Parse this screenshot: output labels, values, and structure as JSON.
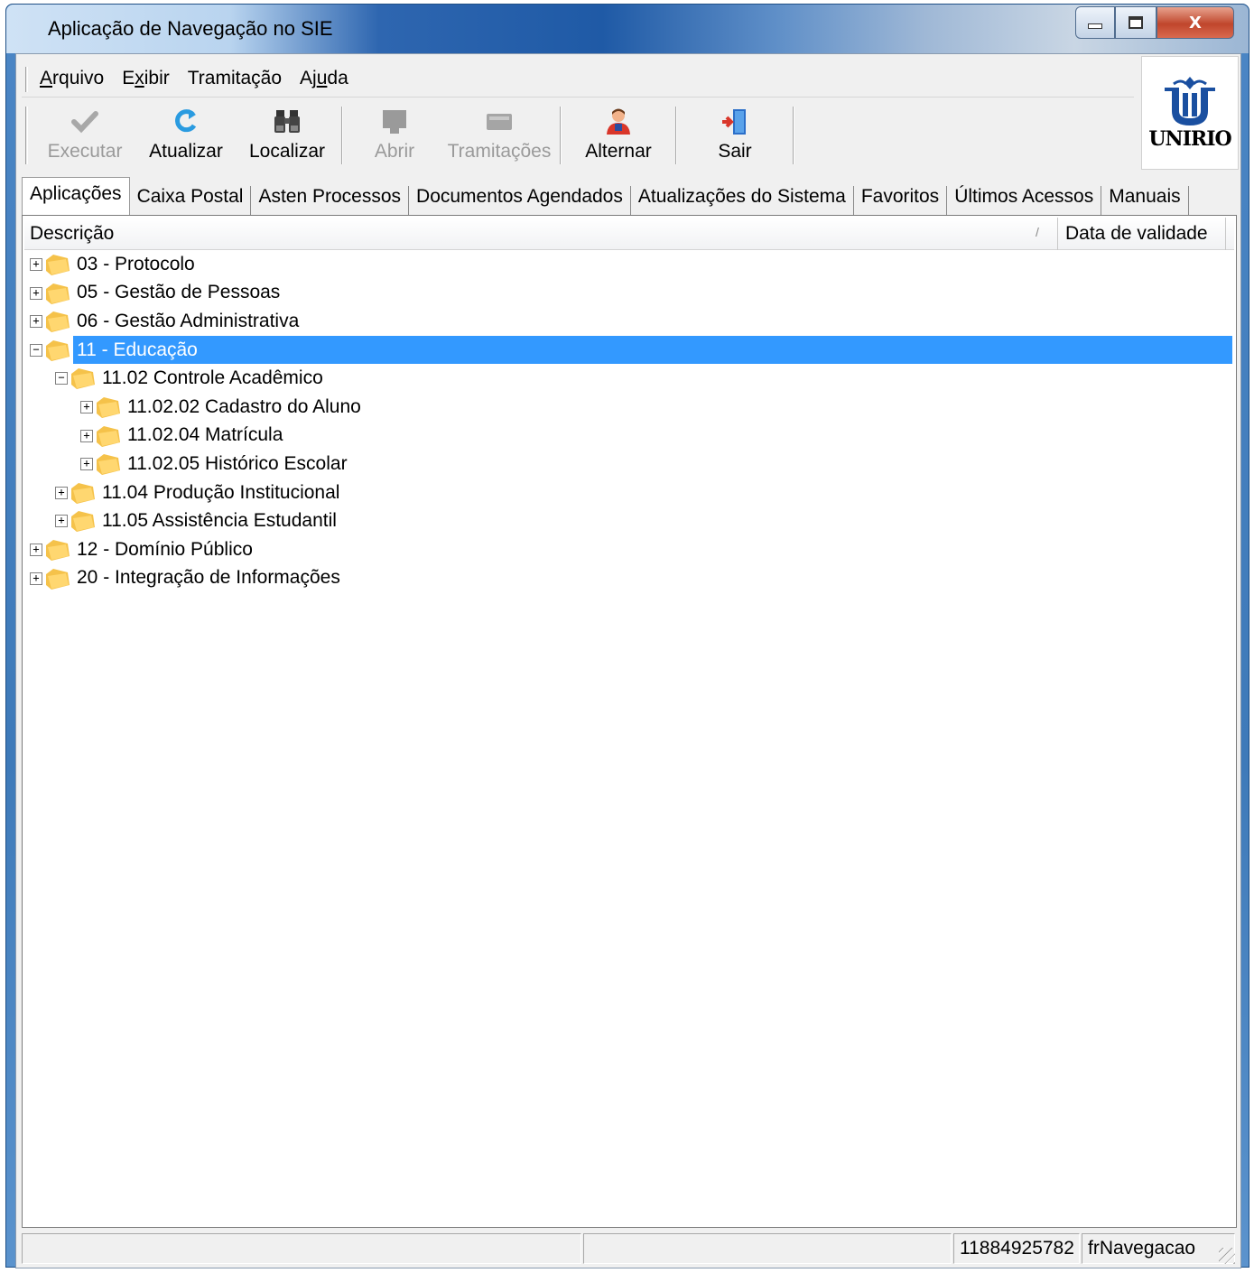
{
  "window": {
    "title": "Aplicação de Navegação no SIE",
    "min_glyph": "▭",
    "max_glyph": "▢",
    "close_glyph": "X"
  },
  "menu": [
    {
      "label": "Arquivo",
      "accel": "A",
      "rest": "rquivo"
    },
    {
      "label": "Exibir",
      "accel": "x",
      "pre": "E",
      "rest": "ibir"
    },
    {
      "label": "Tramitação"
    },
    {
      "label": "Ajuda",
      "accel": "u",
      "pre": "Aj",
      "rest": "da"
    }
  ],
  "toolbar": {
    "executar": "Executar",
    "atualizar": "Atualizar",
    "localizar": "Localizar",
    "abrir": "Abrir",
    "tramitacoes": "Tramitações",
    "alternar": "Alternar",
    "sair": "Sair"
  },
  "logo": {
    "text": "UNIRIO"
  },
  "tabs": [
    "Aplicações",
    "Caixa Postal",
    "Asten Processos",
    "Documentos Agendados",
    "Atualizações do Sistema",
    "Favoritos",
    "Últimos Acessos",
    "Manuais"
  ],
  "list": {
    "columns": {
      "description": "Descrição",
      "sort_indicator": "/",
      "validity": "Data de validade"
    },
    "nodes": [
      {
        "label": "03 - Protocolo",
        "level": 0,
        "expanded": false
      },
      {
        "label": "05 - Gestão de Pessoas",
        "level": 0,
        "expanded": false
      },
      {
        "label": "06 - Gestão Administrativa",
        "level": 0,
        "expanded": false
      },
      {
        "label": "11 - Educação",
        "level": 0,
        "expanded": true,
        "selected": true
      },
      {
        "label": "11.02 Controle Acadêmico",
        "level": 1,
        "expanded": true
      },
      {
        "label": "11.02.02 Cadastro do Aluno",
        "level": 2,
        "expanded": false
      },
      {
        "label": "11.02.04 Matrícula",
        "level": 2,
        "expanded": false
      },
      {
        "label": "11.02.05 Histórico Escolar",
        "level": 2,
        "expanded": false
      },
      {
        "label": "11.04 Produção Institucional",
        "level": 1,
        "expanded": false
      },
      {
        "label": "11.05 Assistência Estudantil",
        "level": 1,
        "expanded": false
      },
      {
        "label": "12 - Domínio Público",
        "level": 0,
        "expanded": false
      },
      {
        "label": "20 - Integração de Informações",
        "level": 0,
        "expanded": false
      }
    ]
  },
  "status": {
    "panel1": "",
    "panel2": "",
    "user_id": "11884925782",
    "form": "frNavegacao"
  },
  "colors": {
    "selection": "#3399ff",
    "folder": "#f5c24a",
    "logo_blue": "#1a4fa0"
  }
}
